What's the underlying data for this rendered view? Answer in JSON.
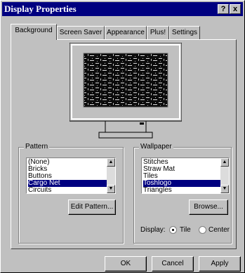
{
  "window": {
    "title": "Display Properties",
    "help_button": "?",
    "close_button": "x"
  },
  "tabs": [
    {
      "label": "Background",
      "active": true
    },
    {
      "label": "Screen Saver",
      "active": false
    },
    {
      "label": "Appearance",
      "active": false
    },
    {
      "label": "Plus!",
      "active": false
    },
    {
      "label": "Settings",
      "active": false
    }
  ],
  "pattern": {
    "legend": "Pattern",
    "items": [
      "(None)",
      "Bricks",
      "Buttons",
      "Cargo Net",
      "Circuits"
    ],
    "selected": "Cargo Net",
    "edit_button": "Edit Pattern..."
  },
  "wallpaper": {
    "legend": "Wallpaper",
    "items": [
      "Stitches",
      "Straw Mat",
      "Tiles",
      "Toshlogo",
      "Triangles"
    ],
    "selected": "Toshlogo",
    "browse_button": "Browse...",
    "display_label": "Display:",
    "options": [
      "Tile",
      "Center"
    ],
    "display_value": "Tile"
  },
  "buttons": {
    "ok": "OK",
    "cancel": "Cancel",
    "apply": "Apply"
  },
  "colors": {
    "titlebar": "#000080",
    "face": "#c0c0c0",
    "selection": "#000080"
  }
}
